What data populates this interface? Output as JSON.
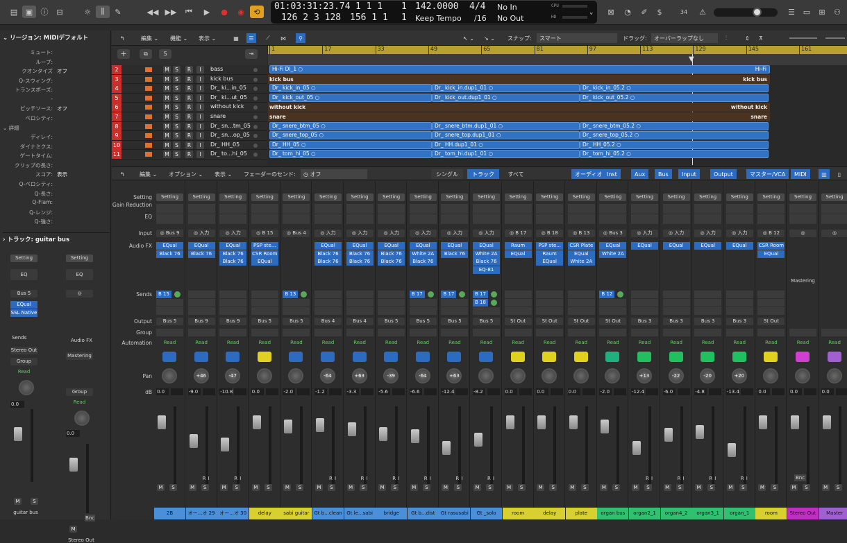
{
  "control_bar": {
    "time": "01:03:31:23.74",
    "bars": "1  1  1",
    "bars_sub": "1",
    "tempo": "142.0000",
    "signature": "4/4",
    "position_bars": "126  2  3  128",
    "position_sub": "156  1  1",
    "position_sub2": "1",
    "tempo_mode": "Keep Tempo",
    "division": "/16",
    "in_label": "No In",
    "out_label": "No Out",
    "cpu_label": "CPU",
    "hd_label": "HD",
    "user_count": "34"
  },
  "inspector": {
    "region_title": "リージョン: MIDIデフォルト",
    "params": [
      {
        "label": "ミュート:",
        "value": ""
      },
      {
        "label": "ループ:",
        "value": ""
      },
      {
        "label": "クオンタイズ",
        "value": "オフ"
      },
      {
        "label": "Q-スウィング:",
        "value": ""
      },
      {
        "label": "トランスポーズ:",
        "value": ""
      },
      {
        "label": "-",
        "value": ""
      },
      {
        "label": "ピッチソース:",
        "value": "オフ"
      },
      {
        "label": "ベロシティ:",
        "value": ""
      }
    ],
    "detail_title": "詳細",
    "detail_params": [
      {
        "label": "ディレイ:",
        "value": ""
      },
      {
        "label": "ダイナミクス:",
        "value": ""
      },
      {
        "label": "ゲートタイム:",
        "value": ""
      },
      {
        "label": "クリップの長さ:",
        "value": ""
      },
      {
        "label": "スコア:",
        "value": "表示"
      },
      {
        "label": "Q-ベロシティ:",
        "value": ""
      },
      {
        "label": "Q-長さ:",
        "value": ""
      },
      {
        "label": "Q-Flam:",
        "value": ""
      },
      {
        "label": "Q-レンジ:",
        "value": ""
      },
      {
        "label": "Q-強さ:",
        "value": ""
      }
    ],
    "track_title": "トラック:  guitar bus",
    "strip1": {
      "setting": "Setting",
      "eq": "EQ",
      "input": "Bus 5",
      "plugins": [
        "EQual",
        "SSL Native"
      ],
      "sends": "Sends",
      "output": "Stereo Out",
      "group": "Group",
      "read": "Read",
      "db": "0.0",
      "name": "guitar bus"
    },
    "strip2": {
      "setting": "Setting",
      "eq": "EQ",
      "audiofx": "Audio FX",
      "plugin": "Mastering",
      "group": "Group",
      "read": "Read",
      "db": "0.0",
      "bnc": "Bnc",
      "name": "Stereo Out"
    }
  },
  "tracks_menu": {
    "edit": "編集",
    "function": "機能",
    "view": "表示",
    "snap_label": "スナップ:",
    "snap_value": "スマート",
    "drag_label": "ドラッグ:",
    "drag_value": "オーバーラップなし"
  },
  "tracks": [
    {
      "num": "2",
      "name": "bass"
    },
    {
      "num": "3",
      "name": "kick bus"
    },
    {
      "num": "4",
      "name": "Dr_ ki...in_05"
    },
    {
      "num": "5",
      "name": "Dr_ ki...ut_05"
    },
    {
      "num": "6",
      "name": "without kick"
    },
    {
      "num": "7",
      "name": "snare"
    },
    {
      "num": "8",
      "name": "Dr_ sn...tm_05"
    },
    {
      "num": "9",
      "name": "Dr_ sn...op_05"
    },
    {
      "num": "10",
      "name": "Dr_ HH_05"
    },
    {
      "num": "11",
      "name": "Dr_ to...hi_05"
    }
  ],
  "ruler": [
    "1",
    "17",
    "33",
    "49",
    "65",
    "81",
    "97",
    "113",
    "129",
    "145",
    "161"
  ],
  "regions": [
    {
      "row": 0,
      "text": "Hi-Fi DI_1",
      "end": "Hi-Fi"
    },
    {
      "row": 1,
      "folder": true,
      "text": "kick bus",
      "end": "kick bus"
    },
    {
      "row": 2,
      "parts": [
        "Dr_ kick_in_05",
        "Dr_ kick_in.dup1_01",
        "Dr_ kick_in_05.2"
      ]
    },
    {
      "row": 3,
      "parts": [
        "Dr_ kick_out_05",
        "Dr_ kick_out.dup1_01",
        "Dr_ kick_out_05.2"
      ]
    },
    {
      "row": 4,
      "folder": true,
      "text": "without kick",
      "end": "without kick"
    },
    {
      "row": 5,
      "folder": true,
      "text": "snare",
      "end": "snare"
    },
    {
      "row": 6,
      "parts": [
        "Dr_ snere_btm_05",
        "Dr_ snere_btm.dup1_01",
        "Dr_ snere_btm_05.2"
      ]
    },
    {
      "row": 7,
      "parts": [
        "Dr_ snere_top_05",
        "Dr_ snere_top.dup1_01",
        "Dr_ snere_top_05.2"
      ]
    },
    {
      "row": 8,
      "parts": [
        "Dr_ HH_05",
        "Dr_ HH.dup1_01",
        "Dr_ HH_05.2"
      ]
    },
    {
      "row": 9,
      "parts": [
        "Dr_ tom_hi_05",
        "Dr_ tom_hi.dup1_01",
        "Dr_ tom_hi_05.2"
      ]
    }
  ],
  "mixer_menu": {
    "edit": "編集",
    "options": "オプション",
    "view": "表示",
    "fader_send_label": "フェーダーのセンド:",
    "fader_send_value": "オフ",
    "single": "シングル",
    "tracks": "トラック",
    "all": "すべて",
    "filters": [
      "オーディオ",
      "Inst",
      "Aux",
      "Bus",
      "Input",
      "Output",
      "マスター/VCA",
      "MIDI"
    ]
  },
  "row_labels": {
    "setting": "Setting",
    "gain": "Gain Reduction",
    "eq": "EQ",
    "input": "Input",
    "audiofx": "Audio FX",
    "sends": "Sends",
    "output": "Output",
    "group": "Group",
    "automation": "Automation",
    "pan": "Pan",
    "db": "dB"
  },
  "strips": [
    {
      "input": "Bus 9",
      "fx": [
        "EQual",
        "Black 76"
      ],
      "sends": [
        [
          "B 15"
        ]
      ],
      "output": "Bus 5",
      "pan": "",
      "db": "0.0",
      "db2": "",
      "name": "2B",
      "color": "#4a8fd8",
      "icon": "#2d6bc0",
      "r": false
    },
    {
      "input": "入力",
      "fx": [
        "EQual",
        "Black 76"
      ],
      "sends": [],
      "output": "Bus 9",
      "pan": "+46",
      "db": "-9.0",
      "db2": "",
      "name": "オー...オ 29",
      "color": "#4a8fd8",
      "icon": "#2d6bc0",
      "r": true
    },
    {
      "input": "入力",
      "fx": [
        "EQual",
        "Black 76",
        "Black 76"
      ],
      "sends": [],
      "output": "Bus 9",
      "pan": "-47",
      "db": "-10.8",
      "db2": "",
      "name": "オー...オ 30",
      "color": "#4a8fd8",
      "icon": "#2d6bc0",
      "r": true
    },
    {
      "input": "B 15",
      "fx": [
        "PSP ste...",
        "CSR Room",
        "EQual"
      ],
      "sends": [],
      "output": "Bus 5",
      "pan": "",
      "db": "0.0",
      "db2": "",
      "name": "delay",
      "color": "#d8d030",
      "icon": "#e0d020",
      "r": false
    },
    {
      "input": "Bus 4",
      "fx": [],
      "sends": [
        [
          "B 13"
        ]
      ],
      "output": "Bus 5",
      "pan": "",
      "db": "-2.0",
      "db2": "",
      "name": "sabi guitar",
      "color": "#d8d030",
      "icon": "#2d6bc0",
      "r": false
    },
    {
      "input": "入力",
      "fx": [
        "EQual",
        "Black 76",
        "Black 76"
      ],
      "sends": [],
      "output": "Bus 4",
      "pan": "-64",
      "db": "-1.2",
      "db2": "",
      "name": "Gt b...clean",
      "color": "#4a8fd8",
      "icon": "#2d6bc0",
      "r": true
    },
    {
      "input": "入力",
      "fx": [
        "EQual",
        "Black 76",
        "Black 76"
      ],
      "sends": [],
      "output": "Bus 4",
      "pan": "+63",
      "db": "-3.3",
      "db2": "",
      "name": "Gt le...sabi",
      "color": "#4a8fd8",
      "icon": "#2d6bc0",
      "r": true
    },
    {
      "input": "入力",
      "fx": [
        "EQual",
        "Black 76",
        "Black 76"
      ],
      "sends": [],
      "output": "Bus 5",
      "pan": "-39",
      "db": "-5.6",
      "db2": "",
      "name": "bridge",
      "color": "#4a8fd8",
      "icon": "#2d6bc0",
      "r": true
    },
    {
      "input": "入力",
      "fx": [
        "EQual",
        "White 2A",
        "Black 76"
      ],
      "sends": [
        [
          "B 17"
        ]
      ],
      "output": "Bus 5",
      "pan": "-64",
      "db": "-6.6",
      "db2": "",
      "name": "Gt b...dist",
      "color": "#4a8fd8",
      "icon": "#2d6bc0",
      "r": true
    },
    {
      "input": "入力",
      "fx": [
        "EQual",
        "Black 76"
      ],
      "sends": [
        [
          "B 17"
        ]
      ],
      "output": "Bus 5",
      "pan": "+63",
      "db": "-12.4",
      "db2": "",
      "name": "Gt rasusabi",
      "color": "#4a8fd8",
      "icon": "#2d6bc0",
      "r": true
    },
    {
      "input": "入力",
      "fx": [
        "EQual",
        "White 2A",
        "Black 76",
        "EQ-81"
      ],
      "sends": [
        [
          "B 17"
        ],
        [
          "B 18"
        ]
      ],
      "output": "Bus 5",
      "pan": "",
      "db": "-8.2",
      "db2": "",
      "name": "Gt _solo",
      "color": "#4a8fd8",
      "icon": "#2d6bc0",
      "r": true
    },
    {
      "input": "B 17",
      "fx": [
        "Raum",
        "EQual"
      ],
      "sends": [],
      "output": "St Out",
      "pan": "",
      "db": "0.0",
      "db2": "",
      "name": "room",
      "color": "#d8d030",
      "icon": "#e0d020",
      "r": false
    },
    {
      "input": "B 18",
      "fx": [
        "PSP ste...",
        "Raum",
        "EQual"
      ],
      "sends": [],
      "output": "St Out",
      "pan": "",
      "db": "0.0",
      "db2": "",
      "name": "delay",
      "color": "#d8d030",
      "icon": "#e0d020",
      "r": false
    },
    {
      "input": "B 13",
      "fx": [
        "CSR Plate",
        "EQual",
        "White 2A"
      ],
      "sends": [],
      "output": "St Out",
      "pan": "",
      "db": "0.0",
      "db2": "",
      "name": "plate",
      "color": "#d8d030",
      "icon": "#e0d020",
      "r": false
    },
    {
      "input": "Bus 3",
      "fx": [
        "EQual",
        "White 2A"
      ],
      "sends": [
        [
          "B 12"
        ]
      ],
      "output": "St Out",
      "pan": "",
      "db": "-2.0",
      "db2": "",
      "name": "organ bus",
      "color": "#30c070",
      "icon": "#20b080",
      "r": false
    },
    {
      "input": "入力",
      "fx": [
        "EQual"
      ],
      "sends": [],
      "output": "Bus 3",
      "pan": "+13",
      "db": "-12.4",
      "db2": "",
      "name": "organ2_1",
      "color": "#30c070",
      "icon": "#20c060",
      "r": true
    },
    {
      "input": "入力",
      "fx": [
        "EQual"
      ],
      "sends": [],
      "output": "Bus 3",
      "pan": "-22",
      "db": "-6.0",
      "db2": "",
      "name": "organ4_2",
      "color": "#30c070",
      "icon": "#20c060",
      "r": true
    },
    {
      "input": "入力",
      "fx": [
        "EQual"
      ],
      "sends": [],
      "output": "Bus 3",
      "pan": "-20",
      "db": "-4.8",
      "db2": "",
      "name": "organ3_1",
      "color": "#30c070",
      "icon": "#20c060",
      "r": true
    },
    {
      "input": "入力",
      "fx": [
        "EQual"
      ],
      "sends": [],
      "output": "Bus 3",
      "pan": "+20",
      "db": "-13.4",
      "db2": "",
      "name": "organ_1",
      "color": "#30c070",
      "icon": "#20c060",
      "r": true
    },
    {
      "input": "B 12",
      "fx": [
        "CSR Room",
        "EQual"
      ],
      "sends": [],
      "output": "St Out",
      "pan": "",
      "db": "0.0",
      "db2": "",
      "name": "room",
      "color": "#d8d030",
      "icon": "#e0d020",
      "r": false
    },
    {
      "input": "",
      "fx": [],
      "sends": [],
      "output": "",
      "pan": "",
      "db": "0.0",
      "db2": "",
      "name": "Stereo Out",
      "color": "#c030c0",
      "icon": "#d040d0",
      "r": false,
      "mastering": "Mastering",
      "bnc": "Bnc"
    },
    {
      "input": "",
      "fx": [],
      "sends": [],
      "output": "",
      "pan": "",
      "db": "0.0",
      "db2": "",
      "name": "Master",
      "color": "#a060d0",
      "icon": "#a060d0",
      "r": false
    }
  ],
  "labels": {
    "setting": "Setting",
    "read": "Read",
    "m": "M",
    "s": "S",
    "r": "R",
    "i": "I"
  }
}
